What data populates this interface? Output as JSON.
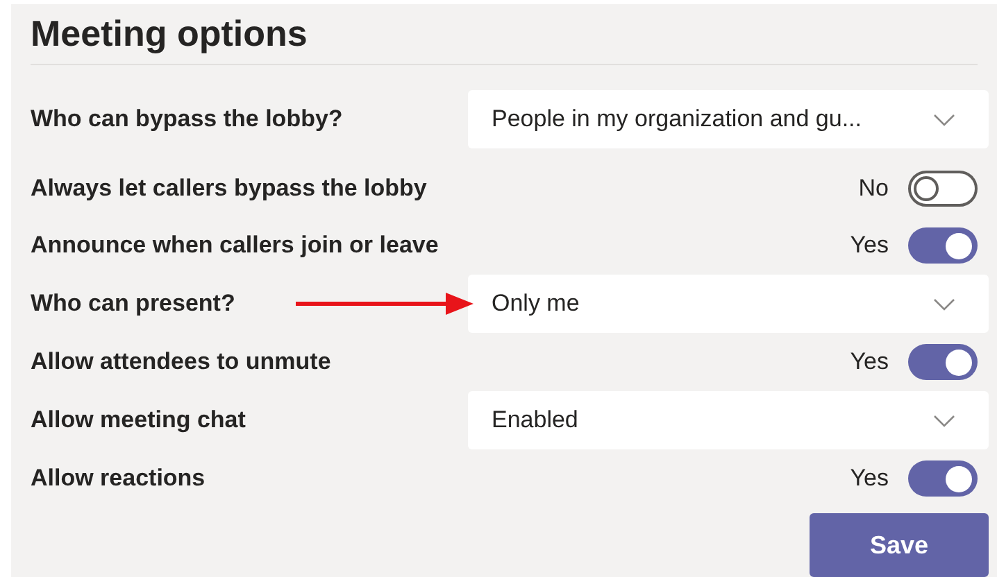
{
  "title": "Meeting options",
  "options": [
    {
      "kind": "dropdown",
      "label": "Who can bypass the lobby?",
      "value": "People in my organization and gu..."
    },
    {
      "kind": "toggle",
      "label": "Always let callers bypass the lobby",
      "state_text": "No",
      "on": false
    },
    {
      "kind": "toggle",
      "label": "Announce when callers join or leave",
      "state_text": "Yes",
      "on": true
    },
    {
      "kind": "dropdown",
      "label": "Who can present?",
      "value": "Only me",
      "annotated": true
    },
    {
      "kind": "toggle",
      "label": "Allow attendees to unmute",
      "state_text": "Yes",
      "on": true
    },
    {
      "kind": "dropdown",
      "label": "Allow meeting chat",
      "value": "Enabled"
    },
    {
      "kind": "toggle",
      "label": "Allow reactions",
      "state_text": "Yes",
      "on": true
    }
  ],
  "save_button": "Save"
}
